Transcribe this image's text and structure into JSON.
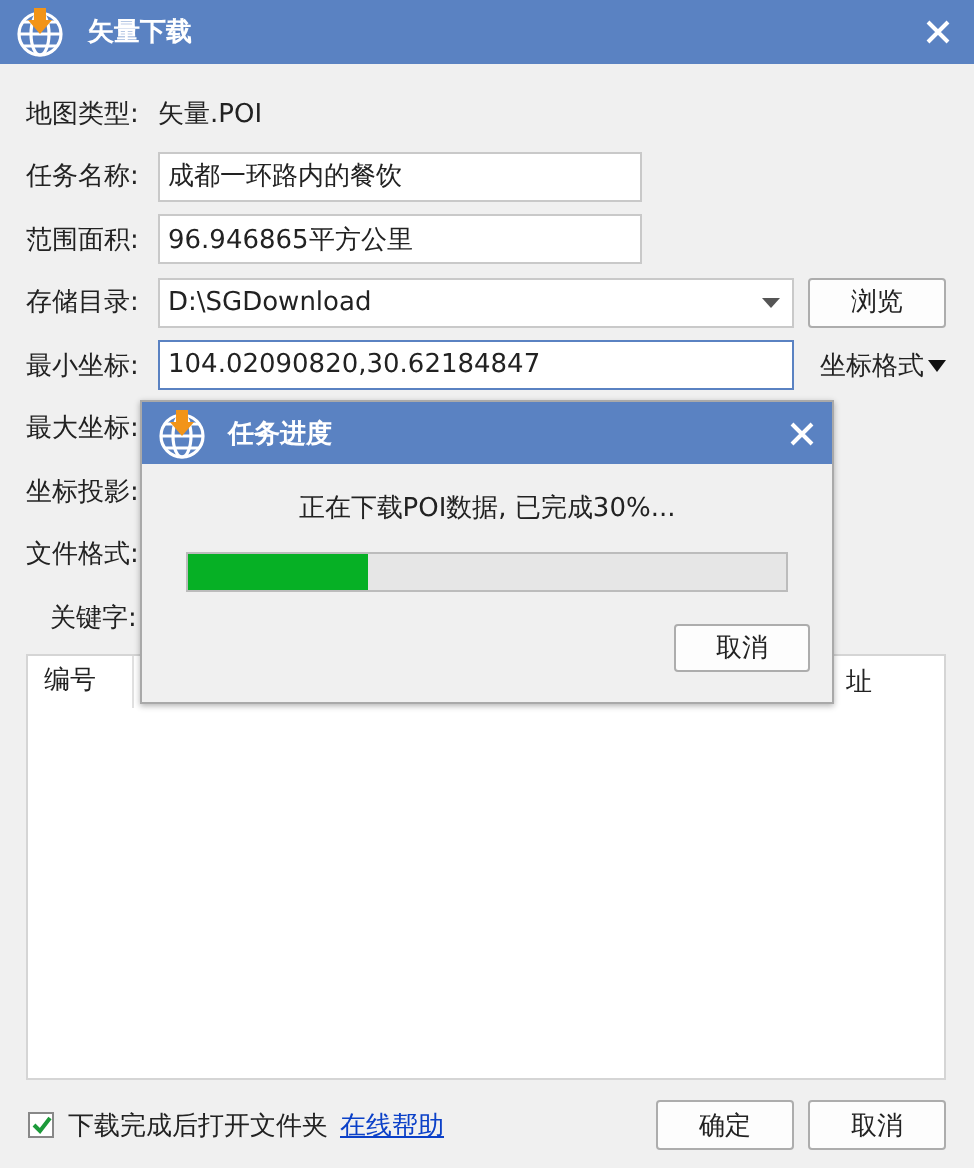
{
  "window": {
    "title": "矢量下载"
  },
  "form": [
    {
      "kind": "static",
      "label": "地图类型:",
      "value": "矢量.POI"
    },
    {
      "kind": "text",
      "label": "任务名称:",
      "value": "成都一环路内的餐饮",
      "focused": false
    },
    {
      "kind": "text",
      "label": "范围面积:",
      "value": "96.946865平方公里",
      "focused": false
    },
    {
      "kind": "combo",
      "label": "存储目录:",
      "value": "D:\\SGDownload",
      "button": "浏览",
      "focused": false
    },
    {
      "kind": "coord",
      "label": "最小坐标:",
      "value": "104.02090820,30.62184847",
      "menu": "坐标格式",
      "focused": true
    },
    {
      "kind": "hidden",
      "label": "最大坐标:"
    },
    {
      "kind": "hidden",
      "label": "坐标投影:"
    },
    {
      "kind": "hidden",
      "label": "文件格式:"
    },
    {
      "kind": "keyword",
      "label": "关键字:"
    }
  ],
  "table": {
    "columns": [
      "编号",
      "址"
    ]
  },
  "footer": {
    "checkbox": {
      "label": "下载完成后打开文件夹",
      "checked": true
    },
    "link": "在线帮助",
    "buttons": [
      "确定",
      "取消"
    ]
  },
  "dialog": {
    "title": "任务进度",
    "message": "正在下载POI数据, 已完成30%...",
    "level": 0.3,
    "button": "取消"
  }
}
